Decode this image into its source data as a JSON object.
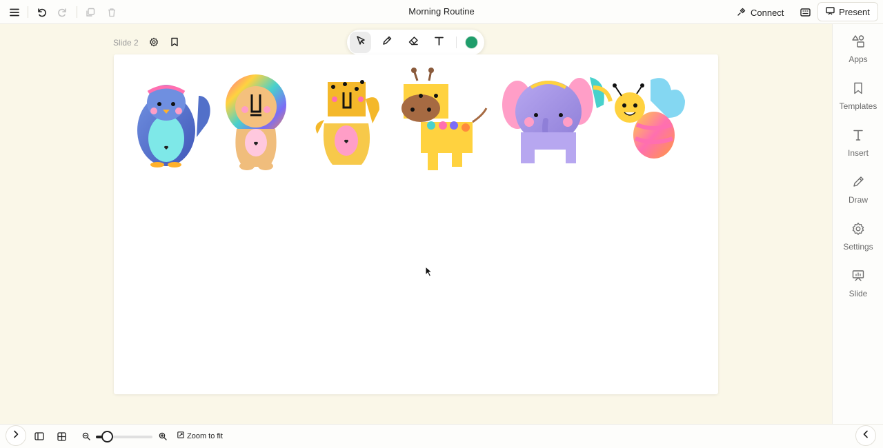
{
  "topbar": {
    "title": "Morning Routine",
    "connect_label": "Connect",
    "present_label": "Present"
  },
  "slide": {
    "label": "Slide 2"
  },
  "toolbar": {
    "active_tool": "select",
    "color": "#1f9d6b"
  },
  "sidebar": {
    "items": [
      {
        "label": "Apps",
        "icon": "apps-shapes-icon"
      },
      {
        "label": "Templates",
        "icon": "bookmark-icon"
      },
      {
        "label": "Insert",
        "icon": "text-insert-icon"
      },
      {
        "label": "Draw",
        "icon": "pencil-icon"
      },
      {
        "label": "Settings",
        "icon": "gear-icon"
      },
      {
        "label": "Slide",
        "icon": "slide-presentation-icon"
      }
    ]
  },
  "bottombar": {
    "zoom_fit_label": "Zoom to fit",
    "zoom_level": 0.2
  },
  "animals": [
    "penguin",
    "lion",
    "leopard",
    "giraffe",
    "elephant",
    "bee"
  ]
}
